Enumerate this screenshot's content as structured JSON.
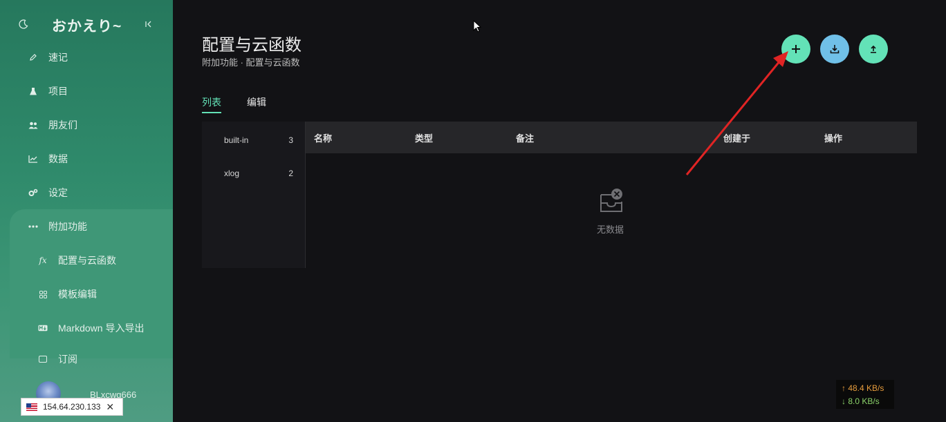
{
  "sidebar": {
    "brand": "おかえり~",
    "items": [
      {
        "label": "速记",
        "icon": "pencil-icon"
      },
      {
        "label": "项目",
        "icon": "flask-icon"
      },
      {
        "label": "朋友们",
        "icon": "users-icon"
      },
      {
        "label": "数据",
        "icon": "chart-line-icon"
      },
      {
        "label": "设定",
        "icon": "gears-icon"
      },
      {
        "label": "附加功能",
        "icon": "ellipsis-icon"
      }
    ],
    "subitems": [
      {
        "label": "配置与云函数",
        "icon": "function-icon"
      },
      {
        "label": "模板编辑",
        "icon": "grid-icon"
      },
      {
        "label": "Markdown 导入导出",
        "icon": "markdown-icon"
      },
      {
        "label": "订阅",
        "icon": "rss-icon"
      }
    ],
    "username": "BLxcwg666"
  },
  "ip_badge": {
    "ip": "154.64.230.133"
  },
  "main": {
    "title": "配置与云函数",
    "breadcrumb": "附加功能 · 配置与云函数",
    "tabs": [
      "列表",
      "编辑"
    ],
    "active_tab": "列表",
    "categories": [
      {
        "name": "built-in",
        "count": "3"
      },
      {
        "name": "xlog",
        "count": "2"
      }
    ],
    "columns": [
      "名称",
      "类型",
      "备注",
      "创建于",
      "操作"
    ],
    "empty_text": "无数据"
  },
  "actions": [
    {
      "name": "add",
      "icon": "plus-icon",
      "color": "#63e2b7"
    },
    {
      "name": "download",
      "icon": "download-icon",
      "color": "#70c0e8"
    },
    {
      "name": "upload",
      "icon": "upload-icon",
      "color": "#63e2b7"
    }
  ],
  "net_speed": {
    "up": "↑ 48.4 KB/s",
    "down": "↓ 8.0 KB/s"
  }
}
